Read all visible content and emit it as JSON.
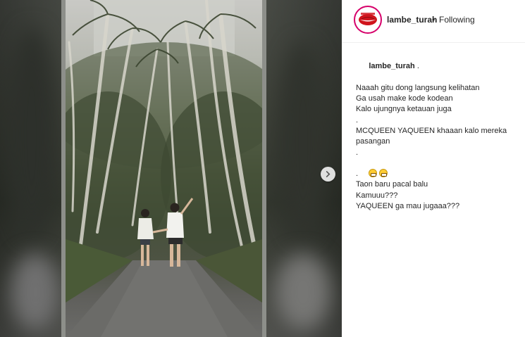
{
  "post": {
    "username": "lambe_turah",
    "separator": "•",
    "follow_status": "Following"
  },
  "caption": {
    "author": "lambe_turah",
    "author_suffix": " .",
    "lines": [
      "Naaah gitu dong langsung kelihatan",
      "Ga usah make kode kodean",
      "Kalo ujungnya ketauan juga",
      ".",
      "MCQUEEN YAQUEEN khaaan kalo mereka",
      "pasangan",
      ".",
      "",
      ".",
      "Taon baru pacal balu",
      "Kamuuu???",
      "YAQUEEN ga mau jugaaa???"
    ],
    "emoji_line_index": 7,
    "emoji_names": [
      "grinning-face-icon",
      "grinning-face-icon"
    ]
  },
  "icons": {
    "next": "chevron-right-icon",
    "avatar": "lips-logo-icon"
  },
  "colors": {
    "avatar_ring": "#d6006a",
    "text": "#262626",
    "divider": "#efefef"
  }
}
